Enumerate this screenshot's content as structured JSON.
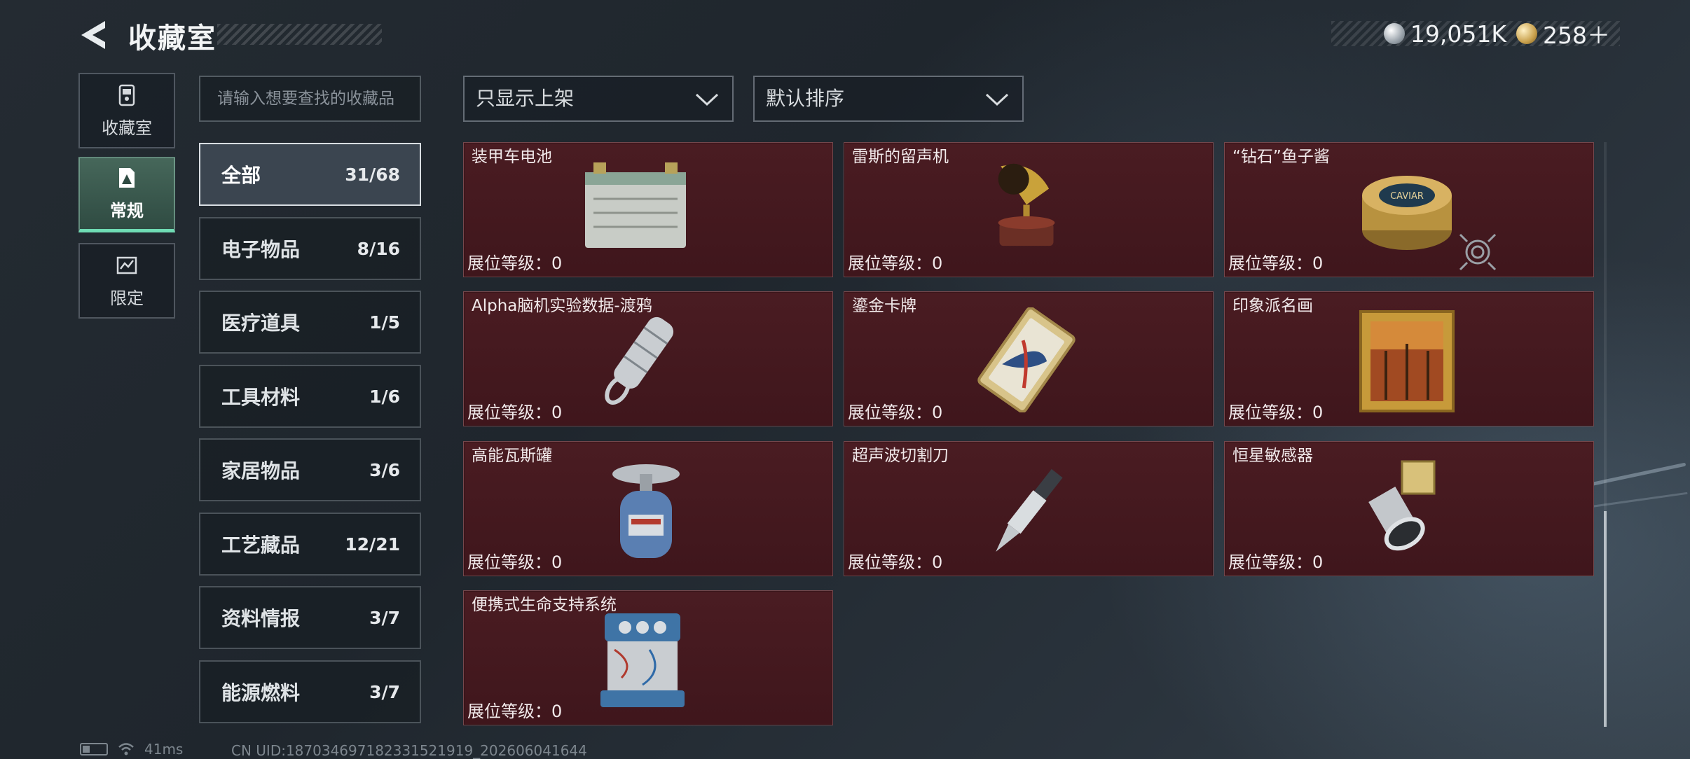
{
  "header": {
    "title": "收藏室",
    "currency": [
      {
        "icon": "silver-coin-icon",
        "value": "19,051K"
      },
      {
        "icon": "gold-coin-icon",
        "value": "258＋"
      }
    ]
  },
  "side_nav": [
    {
      "label": "收藏室",
      "icon": "collection-room-icon",
      "active": false
    },
    {
      "label": "常规",
      "icon": "regular-icon",
      "active": true
    },
    {
      "label": "限定",
      "icon": "limited-icon",
      "active": false
    }
  ],
  "search": {
    "placeholder": "请输入想要查找的收藏品"
  },
  "filters": {
    "filter_label": "只显示上架",
    "sort_label": "默认排序"
  },
  "categories": [
    {
      "name": "全部",
      "count": "31/68",
      "active": true
    },
    {
      "name": "电子物品",
      "count": "8/16"
    },
    {
      "name": "医疗道具",
      "count": "1/5"
    },
    {
      "name": "工具材料",
      "count": "1/6"
    },
    {
      "name": "家居物品",
      "count": "3/6"
    },
    {
      "name": "工艺藏品",
      "count": "12/21"
    },
    {
      "name": "资料情报",
      "count": "3/7"
    },
    {
      "name": "能源燃料",
      "count": "3/7"
    }
  ],
  "items": [
    {
      "name": "装甲车电池",
      "level": "展位等级：0",
      "icon": "armored-car-battery-icon"
    },
    {
      "name": "雷斯的留声机",
      "level": "展位等级：0",
      "icon": "gramophone-icon"
    },
    {
      "name": "“钻石”鱼子酱",
      "level": "展位等级：0",
      "icon": "caviar-tin-icon"
    },
    {
      "name": "Alpha脑机实验数据-渡鸦",
      "level": "展位等级：0",
      "icon": "data-drive-icon"
    },
    {
      "name": "鎏金卡牌",
      "level": "展位等级：0",
      "icon": "gilded-card-icon"
    },
    {
      "name": "印象派名画",
      "level": "展位等级：0",
      "icon": "painting-icon"
    },
    {
      "name": "高能瓦斯罐",
      "level": "展位等级：0",
      "icon": "gas-canister-icon"
    },
    {
      "name": "超声波切割刀",
      "level": "展位等级：0",
      "icon": "ultrasonic-knife-icon"
    },
    {
      "name": "恒星敏感器",
      "level": "展位等级：0",
      "icon": "star-sensor-icon"
    },
    {
      "name": "便携式生命支持系统",
      "level": "展位等级：0",
      "icon": "life-support-icon"
    }
  ],
  "status_bar": {
    "ping": "41ms",
    "uid": "CN UID:187034697182331521919_202606041644"
  }
}
